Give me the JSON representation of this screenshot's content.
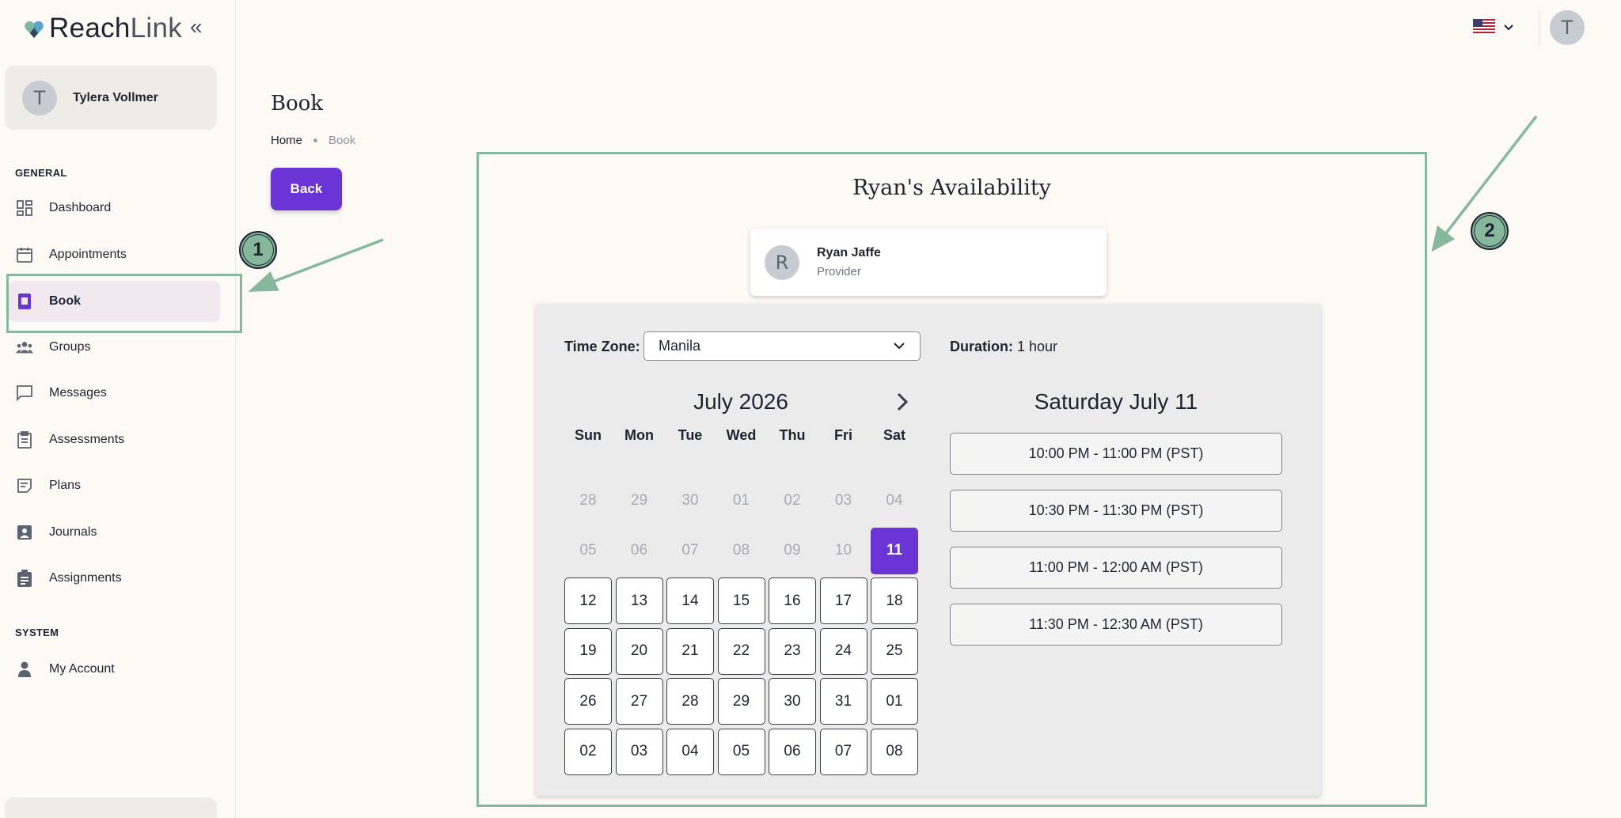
{
  "app": {
    "brand_part1": "Reach",
    "brand_part2": "Link",
    "user_name": "Tylera Vollmer",
    "user_initial": "T"
  },
  "sidebar": {
    "general_label": "GENERAL",
    "system_label": "SYSTEM",
    "items": [
      {
        "label": "Dashboard",
        "icon": "dashboard-icon"
      },
      {
        "label": "Appointments",
        "icon": "calendar-icon"
      },
      {
        "label": "Book",
        "icon": "book-icon",
        "active": true
      },
      {
        "label": "Groups",
        "icon": "groups-icon"
      },
      {
        "label": "Messages",
        "icon": "message-icon"
      },
      {
        "label": "Assessments",
        "icon": "clipboard-icon"
      },
      {
        "label": "Plans",
        "icon": "plans-icon"
      },
      {
        "label": "Journals",
        "icon": "journal-icon"
      },
      {
        "label": "Assignments",
        "icon": "assignment-icon"
      }
    ],
    "system_items": [
      {
        "label": "My Account",
        "icon": "person-icon"
      }
    ]
  },
  "topbar": {
    "language_icon": "us-flag-icon",
    "user_initial": "T"
  },
  "page": {
    "title": "Book",
    "breadcrumb_home": "Home",
    "breadcrumb_current": "Book",
    "back_label": "Back"
  },
  "annotations": {
    "badge1": "1",
    "badge2": "2",
    "color": "#87b89d"
  },
  "availability": {
    "title": "Ryan's Availability",
    "provider_name": "Ryan Jaffe",
    "provider_role": "Provider",
    "provider_initial": "R",
    "timezone_label": "Time Zone:",
    "timezone_value": "Manila",
    "duration_label": "Duration:",
    "duration_value": "1 hour",
    "month_title": "July 2026",
    "weekdays": [
      "Sun",
      "Mon",
      "Tue",
      "Wed",
      "Thu",
      "Fri",
      "Sat"
    ],
    "weeks": [
      [
        {
          "d": "28",
          "s": "muted"
        },
        {
          "d": "29",
          "s": "muted"
        },
        {
          "d": "30",
          "s": "muted"
        },
        {
          "d": "01",
          "s": "muted"
        },
        {
          "d": "02",
          "s": "muted"
        },
        {
          "d": "03",
          "s": "muted"
        },
        {
          "d": "04",
          "s": "muted"
        }
      ],
      [
        {
          "d": "05",
          "s": "muted"
        },
        {
          "d": "06",
          "s": "muted"
        },
        {
          "d": "07",
          "s": "muted"
        },
        {
          "d": "08",
          "s": "muted"
        },
        {
          "d": "09",
          "s": "muted"
        },
        {
          "d": "10",
          "s": "muted"
        },
        {
          "d": "11",
          "s": "selected"
        }
      ],
      [
        {
          "d": "12",
          "s": "avail"
        },
        {
          "d": "13",
          "s": "avail"
        },
        {
          "d": "14",
          "s": "avail"
        },
        {
          "d": "15",
          "s": "avail"
        },
        {
          "d": "16",
          "s": "avail"
        },
        {
          "d": "17",
          "s": "avail"
        },
        {
          "d": "18",
          "s": "avail"
        }
      ],
      [
        {
          "d": "19",
          "s": "avail"
        },
        {
          "d": "20",
          "s": "avail"
        },
        {
          "d": "21",
          "s": "avail"
        },
        {
          "d": "22",
          "s": "avail"
        },
        {
          "d": "23",
          "s": "avail"
        },
        {
          "d": "24",
          "s": "avail"
        },
        {
          "d": "25",
          "s": "avail"
        }
      ],
      [
        {
          "d": "26",
          "s": "avail"
        },
        {
          "d": "27",
          "s": "avail"
        },
        {
          "d": "28",
          "s": "avail"
        },
        {
          "d": "29",
          "s": "avail"
        },
        {
          "d": "30",
          "s": "avail"
        },
        {
          "d": "31",
          "s": "avail"
        },
        {
          "d": "01",
          "s": "avail"
        }
      ],
      [
        {
          "d": "02",
          "s": "avail"
        },
        {
          "d": "03",
          "s": "avail"
        },
        {
          "d": "04",
          "s": "avail"
        },
        {
          "d": "05",
          "s": "avail"
        },
        {
          "d": "06",
          "s": "avail"
        },
        {
          "d": "07",
          "s": "avail"
        },
        {
          "d": "08",
          "s": "avail"
        }
      ]
    ],
    "selected_date_title": "Saturday July 11",
    "slots": [
      "10:00 PM - 11:00 PM (PST)",
      "10:30 PM - 11:30 PM (PST)",
      "11:00 PM - 12:00 AM (PST)",
      "11:30 PM - 12:30 AM (PST)"
    ],
    "accent_color": "#6a35d4"
  }
}
